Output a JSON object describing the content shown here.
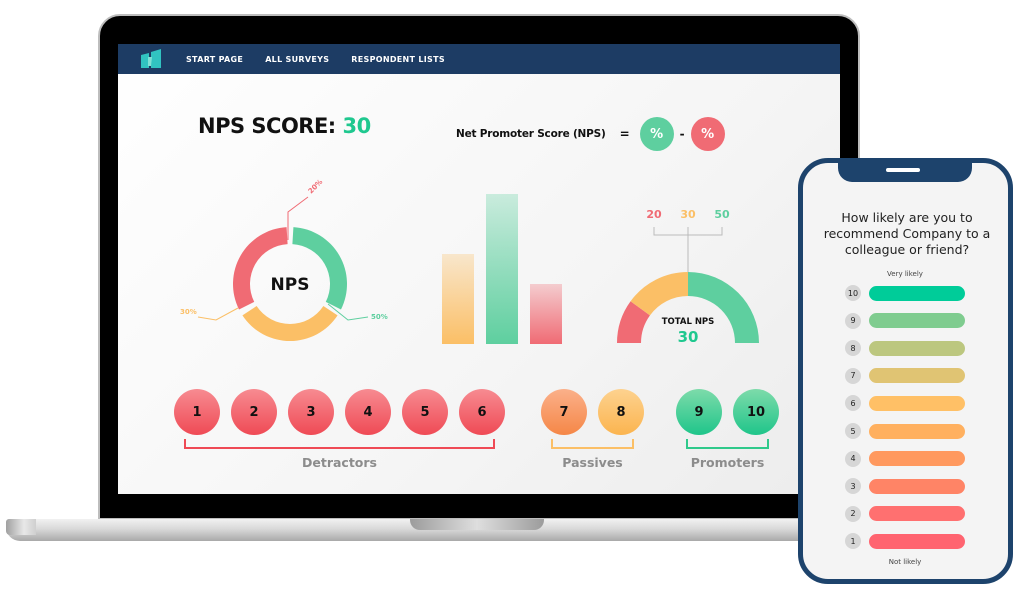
{
  "navbar": {
    "logo": "brand-logo",
    "items": [
      {
        "label": "START PAGE"
      },
      {
        "label": "ALL SURVEYS"
      },
      {
        "label": "RESPONDENT LISTS"
      }
    ]
  },
  "score": {
    "label": "NPS SCORE:",
    "value": "30"
  },
  "formula": {
    "label": "Net Promoter Score (NPS)",
    "equals": "=",
    "promoters_symbol": "%",
    "minus": "-",
    "detractors_symbol": "%"
  },
  "colors": {
    "navy": "#1d3c64",
    "promoter_green": "#5ecf9f",
    "passive_yellow": "#fbbf66",
    "detractor_red": "#f06b74",
    "score_green": "#1fc88f"
  },
  "chart_data": [
    {
      "type": "pie",
      "title": "NPS",
      "categories": [
        "Detractors",
        "Promoters",
        "Passives"
      ],
      "values": [
        20,
        50,
        30
      ],
      "labels": [
        "20%",
        "50%",
        "30%"
      ],
      "colors": [
        "#f06b74",
        "#5ecf9f",
        "#fbbf66"
      ]
    },
    {
      "type": "bar",
      "categories": [
        "Passives",
        "Promoters",
        "Detractors"
      ],
      "values": [
        30,
        50,
        20
      ],
      "colors": [
        "#fbbf66",
        "#5ecf9f",
        "#f06b74"
      ],
      "ylim": [
        0,
        50
      ]
    },
    {
      "type": "pie",
      "subtype": "gauge",
      "title": "TOTAL NPS",
      "total": "30",
      "categories": [
        "Detractors",
        "Passives",
        "Promoters"
      ],
      "values": [
        20,
        30,
        50
      ],
      "labels": [
        "20",
        "30",
        "50"
      ],
      "colors": [
        "#f06b74",
        "#fbbf66",
        "#5ecf9f"
      ]
    }
  ],
  "scale": {
    "groups": [
      {
        "name": "Detractors",
        "numbers": [
          "1",
          "2",
          "3",
          "4",
          "5",
          "6"
        ]
      },
      {
        "name": "Passives",
        "numbers": [
          "7",
          "8"
        ]
      },
      {
        "name": "Promoters",
        "numbers": [
          "9",
          "10"
        ]
      }
    ]
  },
  "phone": {
    "question": "How likely are you to recommend Company to a colleague or friend?",
    "top_label": "Very likely",
    "bottom_label": "Not likely",
    "options": [
      {
        "value": "10",
        "color": "#00cc99"
      },
      {
        "value": "9",
        "color": "#7fcc8f"
      },
      {
        "value": "8",
        "color": "#bcc77f"
      },
      {
        "value": "7",
        "color": "#e0c473"
      },
      {
        "value": "6",
        "color": "#ffc066"
      },
      {
        "value": "5",
        "color": "#ffb05f"
      },
      {
        "value": "4",
        "color": "#ff995f"
      },
      {
        "value": "3",
        "color": "#ff8466"
      },
      {
        "value": "2",
        "color": "#ff7070"
      },
      {
        "value": "1",
        "color": "#ff6470"
      }
    ]
  }
}
